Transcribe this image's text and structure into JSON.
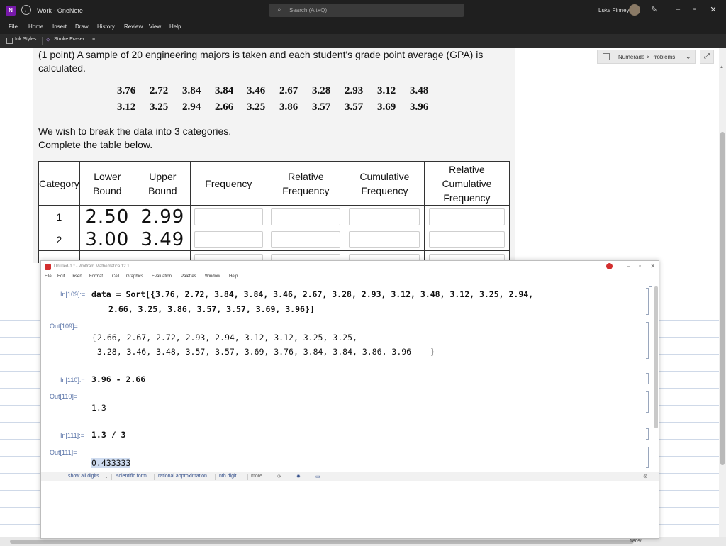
{
  "window": {
    "title": "Work - OneNote",
    "search_placeholder": "Search (Alt+Q)",
    "user_name": "Luke Finney",
    "app_icon_glyph": "N"
  },
  "menu": [
    "File",
    "Home",
    "Insert",
    "Draw",
    "History",
    "Review",
    "View",
    "Help"
  ],
  "ink_toolbar": {
    "ink_styles_label": "Ink Styles",
    "stroke_eraser_label": "Stroke Eraser",
    "overflow_glyph": "≡"
  },
  "numerade": {
    "label": "Numerade > Problems"
  },
  "problem": {
    "intro_line1": "(1 point) A sample of 20 engineering majors is taken and each student's grade point average (GPA) is",
    "intro_line2": "calculated.",
    "row1": [
      "3.76",
      "2.72",
      "3.84",
      "3.84",
      "3.46",
      "2.67",
      "3.28",
      "2.93",
      "3.12",
      "3.48"
    ],
    "row2": [
      "3.12",
      "3.25",
      "2.94",
      "2.66",
      "3.25",
      "3.86",
      "3.57",
      "3.57",
      "3.69",
      "3.96"
    ],
    "instruction1": "We wish to break the data into 3 categories.",
    "instruction2": "Complete the table below.",
    "table": {
      "headers": [
        [
          "Category"
        ],
        [
          "Lower",
          "Bound"
        ],
        [
          "Upper",
          "Bound"
        ],
        [
          "Frequency"
        ],
        [
          "Relative",
          "Frequency"
        ],
        [
          "Cumulative",
          "Frequency"
        ],
        [
          "Relative",
          "Cumulative",
          "Frequency"
        ]
      ],
      "rows": [
        {
          "category": "1",
          "lower": "2.50",
          "upper": "2.99"
        },
        {
          "category": "2",
          "lower": "3.00",
          "upper": "3.49"
        }
      ]
    }
  },
  "mathematica": {
    "title": "Untitled-1 * - Wolfram Mathematica 12.1",
    "menu": [
      "File",
      "Edit",
      "Insert",
      "Format",
      "Cell",
      "Graphics",
      "Evaluation",
      "Palettes",
      "Window",
      "Help"
    ],
    "cells": [
      {
        "in_label": "In[109]:=",
        "in_code_1": "data = Sort[{3.76, 2.72, 3.84, 3.84, 3.46, 2.67, 3.28, 2.93, 3.12, 3.48, 3.12, 3.25, 2.94,",
        "in_code_2": "2.66, 3.25, 3.86, 3.57, 3.57, 3.69, 3.96}]",
        "out_label": "Out[109]=",
        "out_open": "{",
        "out_1": "2.66, 2.67, 2.72, 2.93, 2.94, 3.12, 3.12, 3.25, 3.25,",
        "out_2": "3.28, 3.46, 3.48, 3.57, 3.57, 3.69, 3.76, 3.84, 3.84, 3.86, 3.96",
        "out_close": "}"
      },
      {
        "in_label": "In[110]:=",
        "in_code": "3.96 - 2.66",
        "out_label": "Out[110]=",
        "out": "1.3"
      },
      {
        "in_label": "In[111]:=",
        "in_code": "1.3 / 3",
        "out_label": "Out[111]=",
        "out": "0.433333"
      }
    ],
    "suggestions": [
      "show all digits",
      "scientific form",
      "rational approximation",
      "nth digit...",
      "more..."
    ]
  },
  "status": {
    "zoom": "180%"
  }
}
